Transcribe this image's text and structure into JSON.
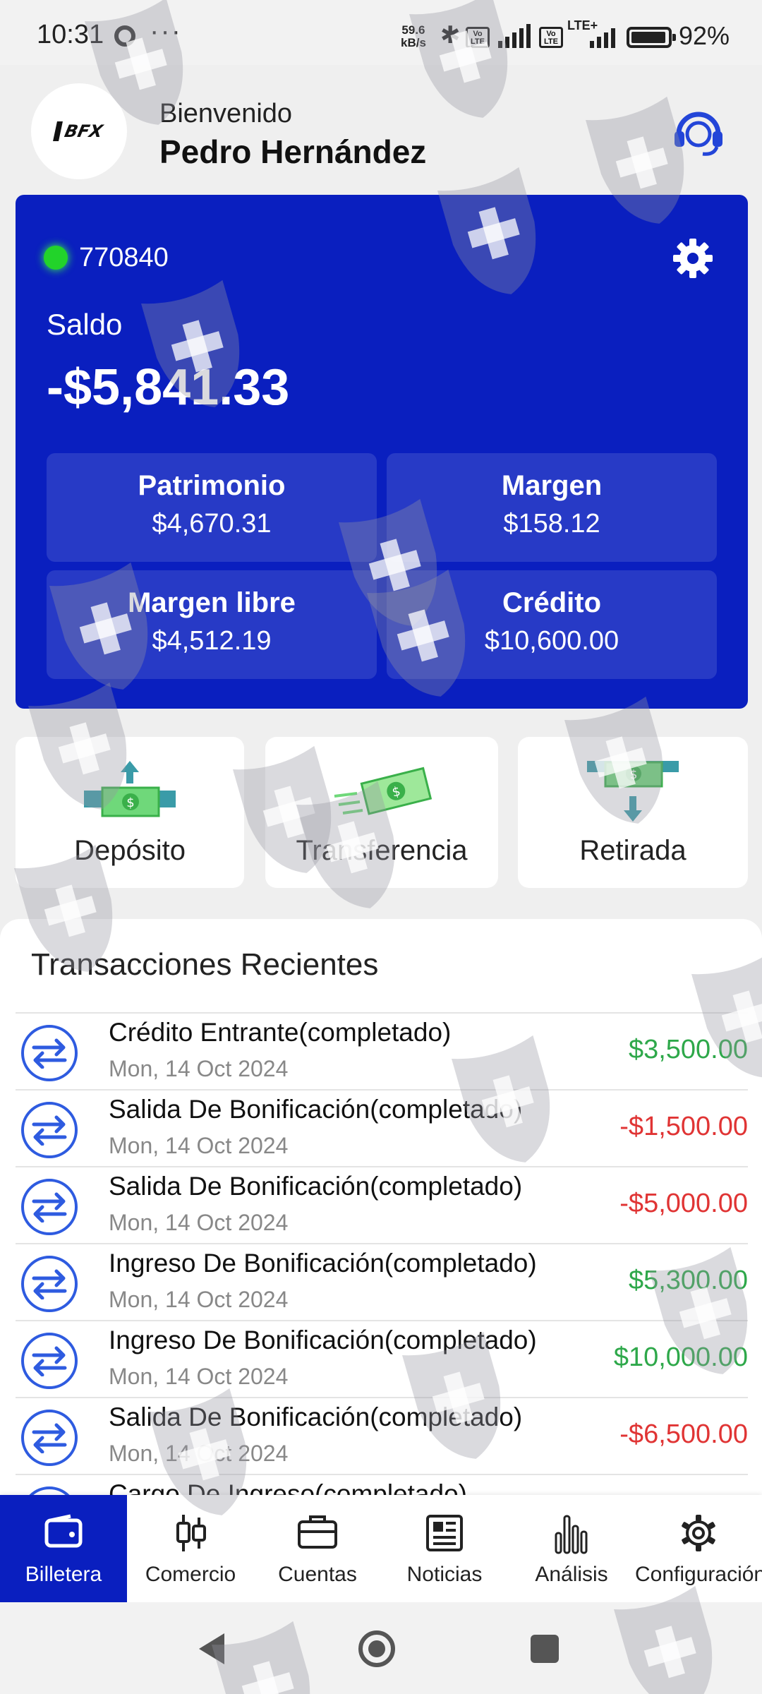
{
  "status_bar": {
    "time": "10:31",
    "dots": "···",
    "net_speed_value": "59.6",
    "net_speed_unit": "kB/s",
    "lte_badge": "Vo LTE",
    "lte_plus": "LTE+",
    "battery": "92%"
  },
  "header": {
    "logo_text": "BFX",
    "welcome": "Bienvenido",
    "user_name": "Pedro Hernández"
  },
  "account": {
    "number": "770840",
    "balance_label": "Saldo",
    "balance": "-$5,841.33",
    "stats": [
      {
        "label": "Patrimonio",
        "value": "$4,670.31"
      },
      {
        "label": "Margen",
        "value": "$158.12"
      },
      {
        "label": "Margen libre",
        "value": "$4,512.19"
      },
      {
        "label": "Crédito",
        "value": "$10,600.00"
      }
    ]
  },
  "actions": {
    "deposit": "Depósito",
    "transfer": "Transferencia",
    "withdraw": "Retirada"
  },
  "transactions": {
    "title": "Transacciones Recientes",
    "items": [
      {
        "title": "Crédito Entrante(completado)",
        "date": "Mon, 14 Oct 2024",
        "amount": "$3,500.00",
        "type": "positive"
      },
      {
        "title": "Salida De Bonificación(completado)",
        "date": "Mon, 14 Oct 2024",
        "amount": "-$1,500.00",
        "type": "negative"
      },
      {
        "title": "Salida De Bonificación(completado)",
        "date": "Mon, 14 Oct 2024",
        "amount": "-$5,000.00",
        "type": "negative"
      },
      {
        "title": "Ingreso De Bonificación(completado)",
        "date": "Mon, 14 Oct 2024",
        "amount": "$5,300.00",
        "type": "positive"
      },
      {
        "title": "Ingreso De Bonificación(completado)",
        "date": "Mon, 14 Oct 2024",
        "amount": "$10,000.00",
        "type": "positive"
      },
      {
        "title": "Salida De Bonificación(completado)",
        "date": "Mon, 14 Oct 2024",
        "amount": "-$6,500.00",
        "type": "negative"
      },
      {
        "title": "Cargo De Ingreso(completado)",
        "date": "",
        "amount": "",
        "type": "partial"
      }
    ]
  },
  "bottom_nav": [
    {
      "label": "Billetera",
      "icon": "wallet-icon",
      "active": true
    },
    {
      "label": "Comercio",
      "icon": "candlestick-icon",
      "active": false
    },
    {
      "label": "Cuentas",
      "icon": "briefcase-icon",
      "active": false
    },
    {
      "label": "Noticias",
      "icon": "newspaper-icon",
      "active": false
    },
    {
      "label": "Análisis",
      "icon": "bar-chart-icon",
      "active": false
    },
    {
      "label": "Configuración",
      "icon": "gear-icon",
      "active": false
    }
  ],
  "colors": {
    "brand_blue": "#0a1fbf",
    "positive": "#2ea84a",
    "negative": "#e03434",
    "online_dot": "#22d32a"
  }
}
